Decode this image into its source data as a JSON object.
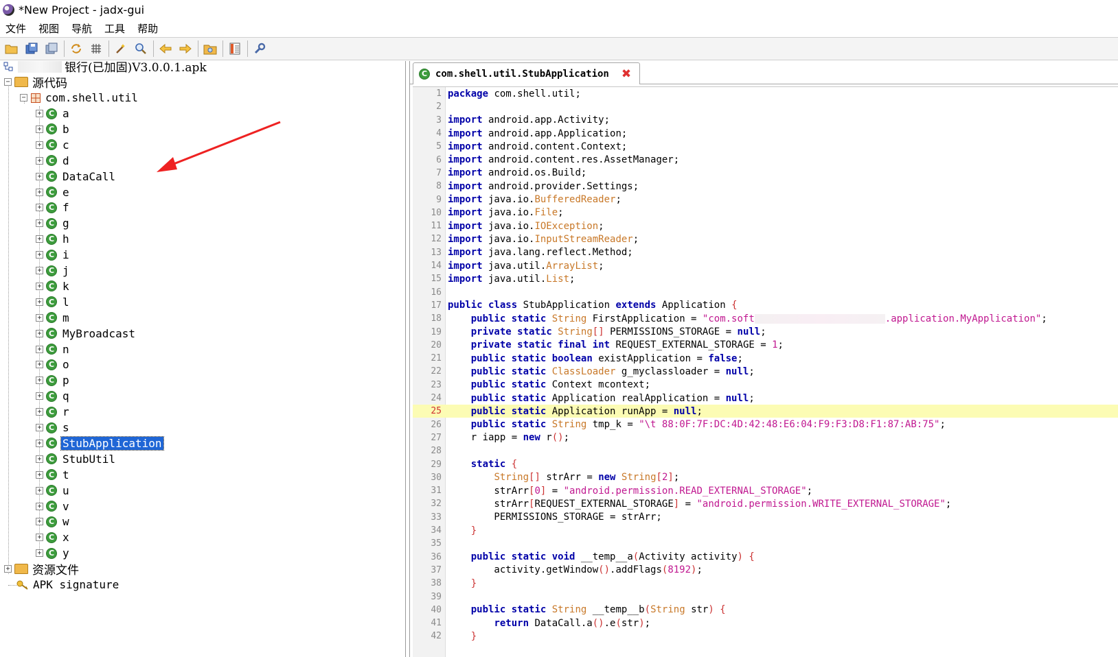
{
  "window": {
    "title": "*New Project - jadx-gui"
  },
  "menu": [
    "文件",
    "视图",
    "导航",
    "工具",
    "帮助"
  ],
  "toolbar": [
    "open-file-icon",
    "save-all-icon",
    "export-icon",
    "sync-icon",
    "flatten-packages-icon",
    "decompile-all-icon",
    "search-icon",
    "back-icon",
    "forward-icon",
    "deobfuscation-icon",
    "log-viewer-icon",
    "preferences-icon"
  ],
  "tree": {
    "root_label": "银行(已加固)V3.0.0.1.apk",
    "source_label": "源代码",
    "package_label": "com.shell.util",
    "classes": [
      "a",
      "b",
      "c",
      "d",
      "DataCall",
      "e",
      "f",
      "g",
      "h",
      "i",
      "j",
      "k",
      "l",
      "m",
      "MyBroadcast",
      "n",
      "o",
      "p",
      "q",
      "r",
      "s",
      "StubApplication",
      "StubUtil",
      "t",
      "u",
      "v",
      "w",
      "x",
      "y"
    ],
    "selected": "StubApplication",
    "resources_label": "资源文件",
    "signature_label": "APK signature"
  },
  "editor": {
    "tab_title": "com.shell.util.StubApplication",
    "highlighted_line": 25,
    "lines": [
      "package com.shell.util;",
      "",
      "import android.app.Activity;",
      "import android.app.Application;",
      "import android.content.Context;",
      "import android.content.res.AssetManager;",
      "import android.os.Build;",
      "import android.provider.Settings;",
      "import java.io.BufferedReader;",
      "import java.io.File;",
      "import java.io.IOException;",
      "import java.io.InputStreamReader;",
      "import java.lang.reflect.Method;",
      "import java.util.ArrayList;",
      "import java.util.List;",
      "",
      "public class StubApplication extends Application {",
      "    public static String FirstApplication = \"com.soft                        .application.MyApplication\";",
      "    private static String[] PERMISSIONS_STORAGE = null;",
      "    private static final int REQUEST_EXTERNAL_STORAGE = 1;",
      "    public static boolean existApplication = false;",
      "    public static ClassLoader g_myclassloader = null;",
      "    public static Context mcontext;",
      "    public static Application realApplication = null;",
      "    public static Application runApp = null;",
      "    public static String tmp_k = \"\\t 88:0F:7F:DC:4D:42:48:E6:04:F9:F3:D8:F1:87:AB:75\";",
      "    r iapp = new r();",
      "",
      "    static {",
      "        String[] strArr = new String[2];",
      "        strArr[0] = \"android.permission.READ_EXTERNAL_STORAGE\";",
      "        strArr[REQUEST_EXTERNAL_STORAGE] = \"android.permission.WRITE_EXTERNAL_STORAGE\";",
      "        PERMISSIONS_STORAGE = strArr;",
      "    }",
      "",
      "    public static void __temp__a(Activity activity) {",
      "        activity.getWindow().addFlags(8192);",
      "    }",
      "",
      "    public static String __temp__b(String str) {",
      "        return DataCall.a().e(str);",
      "    }"
    ]
  },
  "colors": {
    "keyword": "#0000a8",
    "type": "#c87828",
    "string": "#c01890",
    "selection": "#1f66d6",
    "highlight_line": "#fcfcb4",
    "annotation_arrow": "#ee2222"
  }
}
